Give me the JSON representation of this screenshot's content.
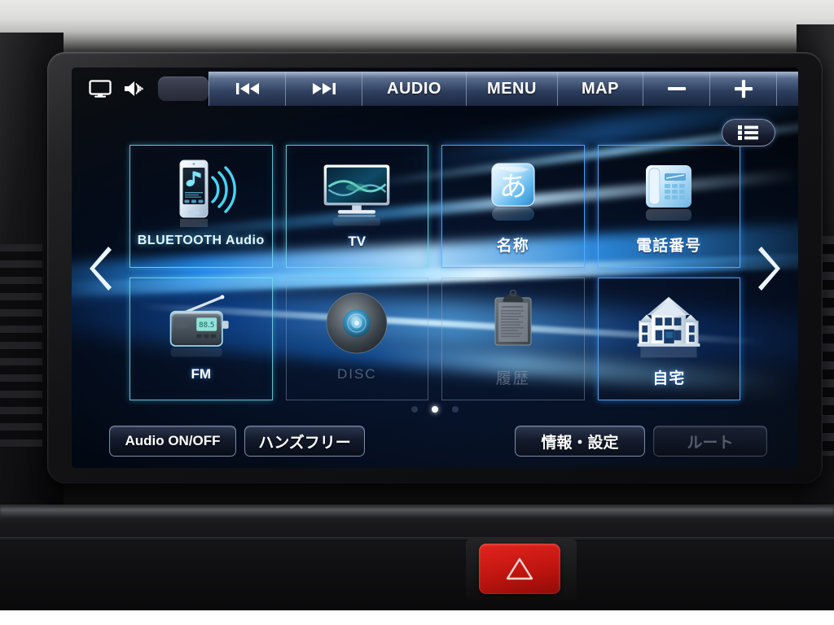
{
  "device": {
    "type": "car-navigation-head-unit",
    "hazard_button": "hazard-warning-triangle"
  },
  "toolbar": {
    "left_icons": [
      {
        "name": "display-monitor-icon",
        "glyph": "monitor"
      },
      {
        "name": "volume-speaker-icon",
        "glyph": "speaker-waves"
      }
    ],
    "volume_slider_value": "",
    "buttons": [
      {
        "name": "track-previous-button",
        "label": "⏮",
        "icon": "prev-track-icon"
      },
      {
        "name": "track-next-button",
        "label": "⏭",
        "icon": "next-track-icon"
      },
      {
        "name": "audio-button",
        "label": "AUDIO"
      },
      {
        "name": "menu-button",
        "label": "MENU"
      },
      {
        "name": "map-button",
        "label": "MAP"
      },
      {
        "name": "volume-down-button",
        "label": "–",
        "icon": "minus-icon"
      },
      {
        "name": "volume-up-button",
        "label": "+",
        "icon": "plus-icon"
      },
      {
        "name": "screen-split-button",
        "label": "",
        "icon": "split-screen-icon"
      }
    ]
  },
  "list_button": {
    "name": "list-view-button",
    "icon": "list-icon"
  },
  "tiles": [
    {
      "id": "bluetooth-audio",
      "label": "BLUETOOTH Audio",
      "icon": "smartphone-bluetooth-audio-icon",
      "enabled": true,
      "frame": "cyan"
    },
    {
      "id": "tv",
      "label": "TV",
      "icon": "television-icon",
      "enabled": true,
      "frame": "cyan"
    },
    {
      "id": "name-search",
      "label": "名称",
      "icon": "hiragana-a-key-icon",
      "enabled": true,
      "frame": "blue"
    },
    {
      "id": "phone-number",
      "label": "電話番号",
      "icon": "desk-telephone-icon",
      "enabled": true,
      "frame": "blue"
    },
    {
      "id": "fm-radio",
      "label": "FM",
      "icon": "portable-radio-icon",
      "enabled": true,
      "frame": "cyan"
    },
    {
      "id": "disc",
      "label": "DISC",
      "icon": "compact-disc-icon",
      "enabled": false,
      "frame": "dim"
    },
    {
      "id": "history",
      "label": "履歴",
      "icon": "clipboard-history-icon",
      "enabled": false,
      "frame": "dim"
    },
    {
      "id": "home",
      "label": "自宅",
      "icon": "house-icon",
      "enabled": true,
      "frame": "blue"
    }
  ],
  "pagination": {
    "total": 3,
    "current": 2
  },
  "nav_arrows": {
    "left": "prev-page-arrow",
    "right": "next-page-arrow"
  },
  "bottom_buttons": [
    {
      "id": "audio-on-off",
      "label": "Audio ON/OFF",
      "enabled": true
    },
    {
      "id": "hands-free",
      "label": "ハンズフリー",
      "enabled": true
    },
    {
      "id": "info-settings",
      "label": "情報・設定",
      "enabled": true
    },
    {
      "id": "route",
      "label": "ルート",
      "enabled": false
    }
  ],
  "colors": {
    "accent_cyan": "#4ad8f0",
    "accent_blue": "#3a9bff",
    "toolbar_blue": "#2c3d5d",
    "hazard_red": "#d4170f",
    "screen_black": "#000000"
  }
}
